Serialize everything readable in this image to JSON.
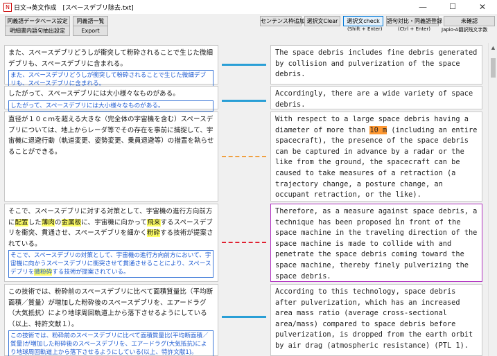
{
  "window": {
    "title": "日文→英文作成　[スペースデブリ除去.txt]",
    "minimize": "—",
    "maximize": "☐",
    "close": "✕"
  },
  "toolbar": {
    "term_db": "同義語データベース設定",
    "term_list": "同義語一覧",
    "extract": "明細書内語句抽出設定",
    "export": "Export",
    "add_sentence": "センテンス枠追加",
    "clear": "選択文Clear",
    "check": "選択文check",
    "check_hint": "(Shift + Enter)",
    "compare": "語句対比・同義語登録",
    "compare_hint": "(Ctrl + Enter)",
    "unconfirmed": "未確認",
    "counter": "Japio-A翻訳残文字数"
  },
  "pairs": [
    {
      "jp": "また、スペースデブリどうしが衝突して粉砕されることで生じた微細デブリも、スペースデブリに含まれる。",
      "jp_mt": "また、スペースデブリどうしが衝突して粉砕されることで生じた微細デブリも、スペースデブリに含まれる。",
      "en": "The space debris includes fine debris generated by collision and pulverization of the space debris."
    },
    {
      "jp": "したがって、スペースデブリには大小様々なものがある。",
      "jp_mt": "したがって、スペースデブリには大小様々なものがある。",
      "en": "Accordingly, there are a wide variety of space debris."
    },
    {
      "jp": "直径が１０ｃｍを超える大きな（完全体の宇宙機を含む）スペースデブリについては、地上からレーダ等でその存在を事前に捕捉して、宇宙機に退避行動（軌道変更、姿勢変更、乗員退避等）の措置を執らせることができる。",
      "en_pre": "With respect to a large space debris having a diameter of more than ",
      "en_hl": "10 m",
      "en_post": " (including an entire spacecraft), the presence of the space debris can be captured in advance by a radar or the like from the ground, the spacecraft can be caused to take measures of a retraction (a trajectory change, a posture change, an occupant retraction, or the like)."
    },
    {
      "jp_a": "そこで、スペースデブリに対する対策として、宇宙機の進行方向前方に",
      "jp_b": "配置",
      "jp_c": "した",
      "jp_d": "薄肉",
      "jp_e": "の",
      "jp_f": "金属板",
      "jp_g": "に、宇宙機に向かって",
      "jp_h": "飛来",
      "jp_i": "するスペースデブリを衝突、貫通させ、スペースデブリを細かく",
      "jp_j": "粉砕",
      "jp_k": "する技術が提案されている。",
      "jp_mt_a": "そこで、スペースデブリの対策として、宇宙機の進行方向前方において、宇宙機に向かうスペースデブリに衝突させて貫通させることにより、スペースデブリを",
      "jp_mt_b": "微粉砕",
      "jp_mt_c": "する技術が提案されている。",
      "en_pre": "Therefore, as a measure against space debris, a technique has been proposed ",
      "en_post": "in front of the space machine in the traveling direction of the space machine is made to collide with and penetrate the space debris coming toward the space machine, thereby finely pulverizing the space debris."
    },
    {
      "jp": "この技術では、粉砕前のスペースデブリに比べて面積質量比（平均断面積／質量）が増加した粉砕後のスペースデブリを、エアードラグ（大気抵抗）により地球周回軌道上から落下させるようにしている（以上、特許文献１）。",
      "jp_mt": "この技術では、粉砕前のスペースデブリに比べて面積質量比(平均断面積／質量)が増加した粉砕後のスペースデブリを、エアードラグ(大気抵抗)により地球周回軌道上から落下させるようにしている(以上、特許文献1)。",
      "en": "According to this technology, space debris after pulverization, which has an increased area mass ratio (average cross-sectional area/mass) compared to space debris before pulverization, is dropped from the earth orbit by air drag (atmospheric resistance) (PTL 1)."
    }
  ],
  "colors": {
    "link_ok": "#2a9fd6",
    "link_warn": "#f0a040",
    "link_error": "#e02030",
    "selected_border": "#b030c0",
    "mt_text": "#1e5bd2"
  }
}
